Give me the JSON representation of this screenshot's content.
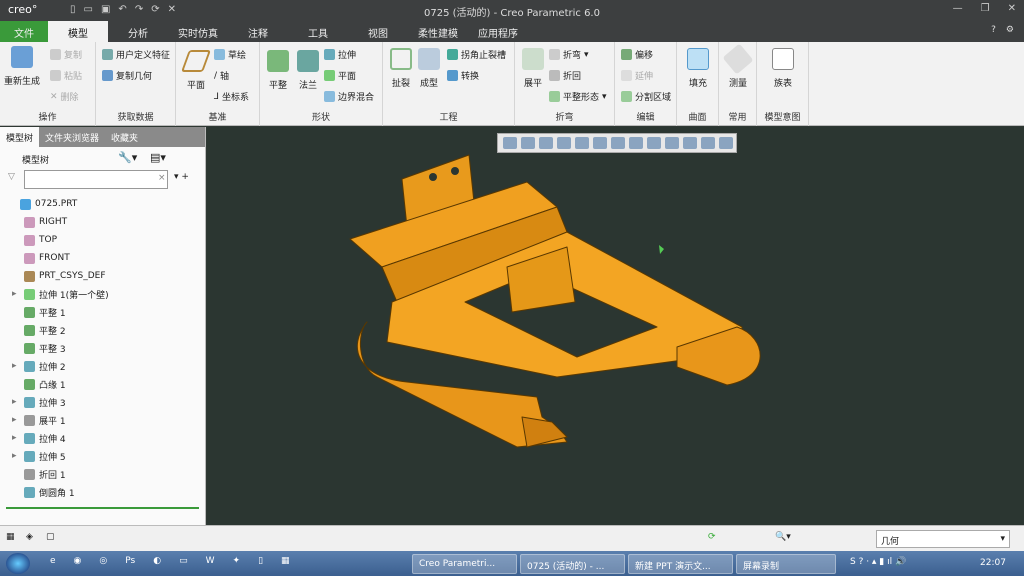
{
  "titlebar": {
    "logo": "creo°",
    "title": "0725 (活动的) - Creo Parametric 6.0"
  },
  "tabs": [
    "文件",
    "模型",
    "分析",
    "实时仿真",
    "注释",
    "工具",
    "视图",
    "柔性建模",
    "应用程序"
  ],
  "ribbon": {
    "ops": {
      "regen": "重新生成",
      "copy": "复制",
      "paste": "粘贴",
      "delete": "删除",
      "label": "操作"
    },
    "getdata": {
      "udf": "用户定义特征",
      "copygeom": "复制几何",
      "label": "获取数据"
    },
    "datum": {
      "plane": "平面",
      "sketch": "草绘",
      "axis": "轴",
      "csys": "坐标系",
      "label": "基准"
    },
    "shape": {
      "flat": "平整",
      "flange": "法兰",
      "extrude": "拉伸",
      "planar": "平面",
      "blend": "边界混合",
      "label": "形状"
    },
    "eng": {
      "rip": "扯裂",
      "form": "成型",
      "corner": "拐角止裂槽",
      "convert": "转换",
      "label": "工程"
    },
    "bend": {
      "unbend": "展平",
      "bend": "折弯",
      "bendback": "折回",
      "flatstate": "平整形态",
      "label": "折弯"
    },
    "edit": {
      "offset": "偏移",
      "extend": "延伸",
      "split": "分割区域",
      "label": "编辑"
    },
    "surface": {
      "fill": "填充",
      "label": "曲面"
    },
    "common": {
      "measure": "测量",
      "label": "常用"
    },
    "intent": {
      "family": "族表",
      "label": "模型意图"
    }
  },
  "left": {
    "tabs": [
      "模型树",
      "文件夹浏览器",
      "收藏夹"
    ],
    "header": "模型树",
    "search_placeholder": "",
    "tree": [
      {
        "label": "0725.PRT",
        "exp": false,
        "lvl": 0,
        "c": "#4aa3df"
      },
      {
        "label": "RIGHT",
        "lvl": 1,
        "c": "#c9b"
      },
      {
        "label": "TOP",
        "lvl": 1,
        "c": "#c9b"
      },
      {
        "label": "FRONT",
        "lvl": 1,
        "c": "#c9b"
      },
      {
        "label": "PRT_CSYS_DEF",
        "lvl": 1,
        "c": "#a85"
      },
      {
        "label": "拉伸 1(第一个壁)",
        "exp": true,
        "lvl": 1,
        "c": "#7c7"
      },
      {
        "label": "平整 1",
        "lvl": 1,
        "c": "#6a6"
      },
      {
        "label": "平整 2",
        "lvl": 1,
        "c": "#6a6"
      },
      {
        "label": "平整 3",
        "lvl": 1,
        "c": "#6a6"
      },
      {
        "label": "拉伸 2",
        "exp": true,
        "lvl": 1,
        "c": "#6ab"
      },
      {
        "label": "凸缘 1",
        "lvl": 1,
        "c": "#6a6"
      },
      {
        "label": "拉伸 3",
        "exp": true,
        "lvl": 1,
        "c": "#6ab"
      },
      {
        "label": "展平 1",
        "exp": true,
        "lvl": 1,
        "c": "#999"
      },
      {
        "label": "拉伸 4",
        "exp": true,
        "lvl": 1,
        "c": "#6ab"
      },
      {
        "label": "拉伸 5",
        "exp": true,
        "lvl": 1,
        "c": "#6ab"
      },
      {
        "label": "折回 1",
        "lvl": 1,
        "c": "#999"
      },
      {
        "label": "倒圆角 1",
        "lvl": 1,
        "c": "#6ab"
      }
    ]
  },
  "status": {
    "filter": "几何"
  },
  "taskbar": {
    "items": [
      "Creo Parametri...",
      "0725 (活动的) - ...",
      "新建 PPT 演示文...",
      "屏幕录制"
    ],
    "clock": "22:07"
  },
  "colors": {
    "model": "#f0a020",
    "viewport": "#2b3631",
    "file_tab": "#3a9a3a"
  }
}
